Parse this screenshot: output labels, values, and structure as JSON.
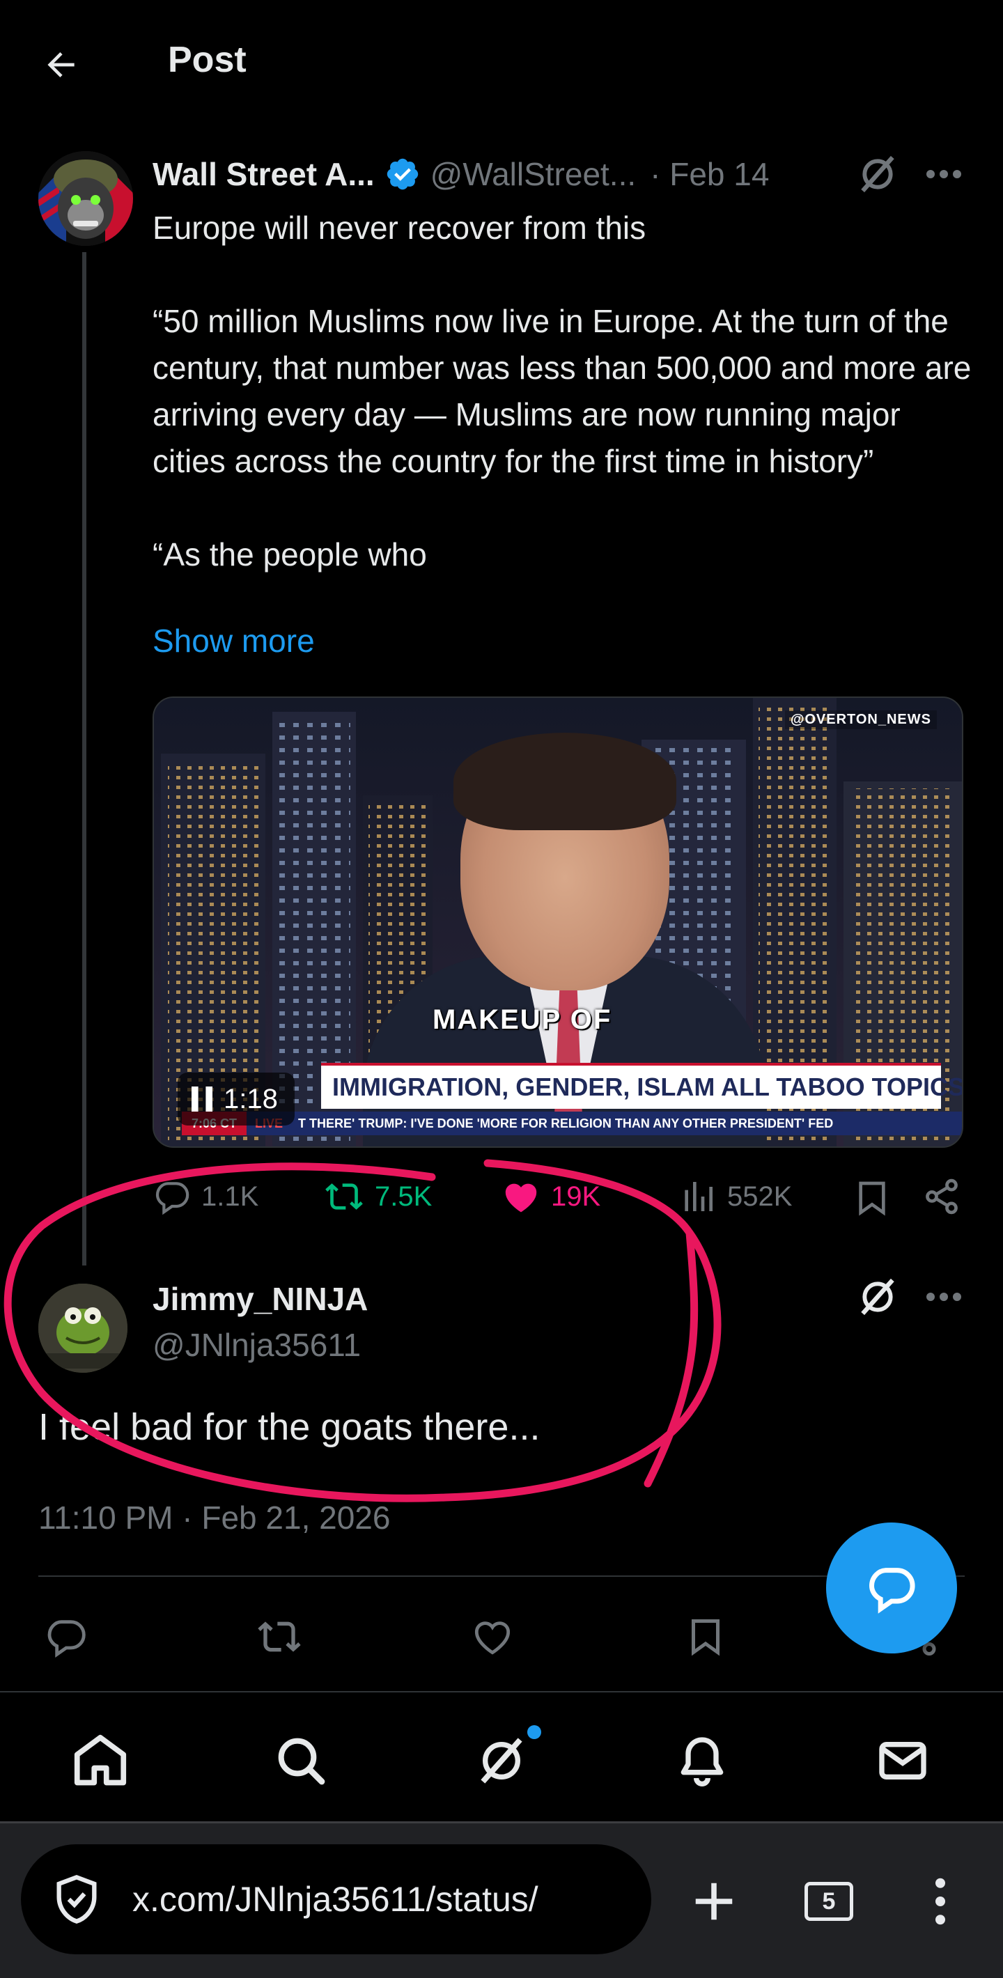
{
  "header": {
    "title": "Post"
  },
  "post": {
    "author_name": "Wall Street A...",
    "author_handle": "@WallStreet...",
    "date": "· Feb 14",
    "text": "Europe will never recover from this\n\n“50 million Muslims now live in Europe. At the turn of the century, that number was less than 500,000 and more are arriving every day — Muslims are now running major cities across the country for the first time in history”\n\n“As the people who",
    "show_more": "Show more",
    "video": {
      "watermark": "@OVERTON_NEWS",
      "chyron_top": "MAKEUP OF",
      "chyron_main": "IMMIGRATION, GENDER, ISLAM ALL TABOO TOPICS",
      "chyron_time": "7:06 CT",
      "chyron_live": "LIVE",
      "chyron_ticker": "T THERE'    TRUMP: I'VE DONE 'MORE FOR RELIGION THAN ANY OTHER PRESIDENT'    FED",
      "duration": "1:18"
    },
    "stats": {
      "replies": "1.1K",
      "reposts": "7.5K",
      "likes": "19K",
      "views": "552K"
    }
  },
  "reply": {
    "author_name": "Jimmy_NINJA",
    "author_handle": "@JNlnja35611",
    "text": "I feel bad for the goats there...",
    "timestamp": "11:10 PM · Feb 21, 2026"
  },
  "browser": {
    "url": "x.com/JNlnja35611/status/",
    "tab_count": "5"
  },
  "colors": {
    "accent": "#1d9bf0",
    "repost": "#00ba7c",
    "like": "#f91880",
    "muted": "#71767b",
    "annotation": "#e8175d"
  },
  "icons": [
    "back-arrow-icon",
    "verified-badge-icon",
    "grok-icon",
    "more-icon",
    "reply-icon",
    "repost-icon",
    "heart-icon",
    "views-icon",
    "bookmark-icon",
    "share-icon",
    "home-icon",
    "search-icon",
    "bell-icon",
    "mail-icon",
    "shield-icon",
    "plus-icon",
    "kebab-icon",
    "pause-icon",
    "compose-icon"
  ]
}
